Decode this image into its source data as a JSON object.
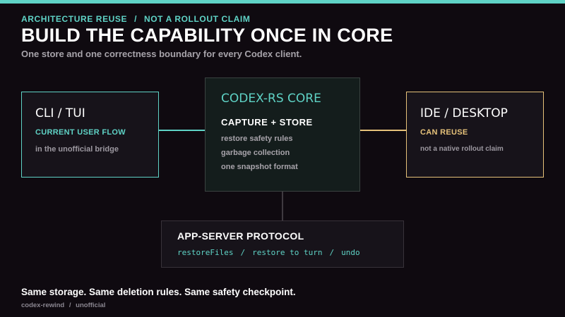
{
  "header": {
    "eyebrow": [
      "ARCHITECTURE REUSE",
      "NOT A ROLLOUT CLAIM"
    ],
    "eyebrow_separator": "/",
    "title": "BUILD THE CAPABILITY ONCE IN CORE",
    "subtitle": "One store and one correctness boundary for every Codex client."
  },
  "cli_box": {
    "heading": "CLI / TUI",
    "tag": "CURRENT USER FLOW",
    "note": "in the unofficial bridge"
  },
  "core_box": {
    "heading": "CODEX-RS CORE",
    "subheading": "CAPTURE + STORE",
    "items": [
      "restore safety rules",
      "garbage collection",
      "one snapshot format"
    ]
  },
  "ide_box": {
    "heading": "IDE / DESKTOP",
    "tag": "CAN REUSE",
    "note": "not a native rollout claim"
  },
  "app_server_box": {
    "heading": "APP-SERVER PROTOCOL",
    "methods": [
      "restoreFiles",
      "restore to turn",
      "undo"
    ],
    "method_separator": "/"
  },
  "footer": {
    "statement": "Same storage. Same deletion rules. Same safety checkpoint.",
    "credit": [
      "codex-rewind",
      "unofficial"
    ],
    "credit_separator": "/"
  },
  "colors": {
    "background": "#0f0a10",
    "accent_teal": "#5fd3c6",
    "accent_gold": "#e6c27a",
    "core_fill": "#141d1c"
  }
}
